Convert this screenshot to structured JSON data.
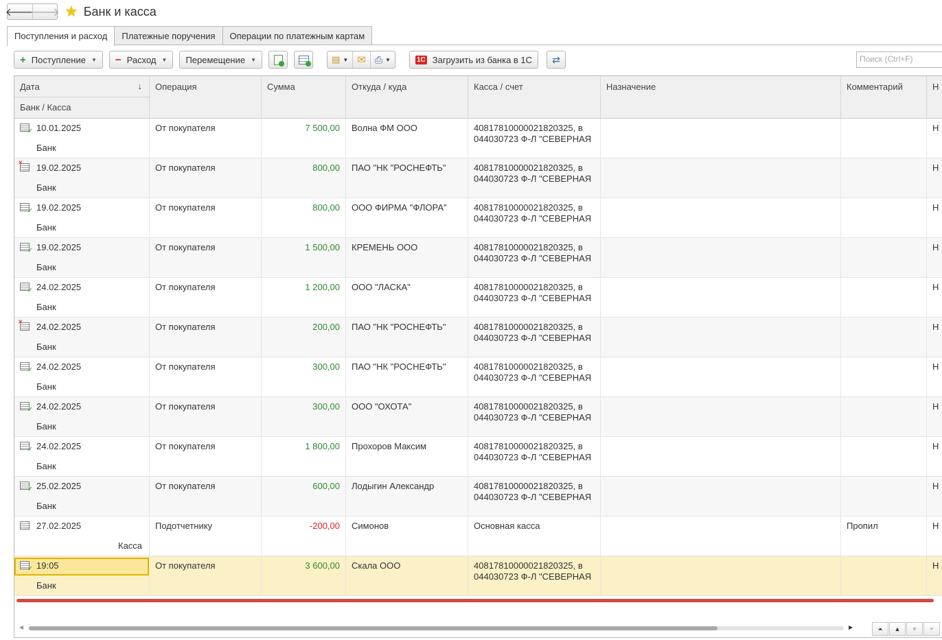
{
  "window": {
    "title": "Банк и касса"
  },
  "tabs": [
    "Поступления и расход",
    "Платежные поручения",
    "Операции по платежным картам"
  ],
  "toolbar": {
    "income_label": "Поступление",
    "expense_label": "Расход",
    "move_label": "Перемещение",
    "load_label": "Загрузить из банка в 1С",
    "c1_badge": "1С"
  },
  "search": {
    "placeholder": "Поиск (Ctrl+F)"
  },
  "columns": {
    "date": "Дата",
    "bank": "Банк / Касса",
    "operation": "Операция",
    "sum": "Сумма",
    "from": "Откуда / куда",
    "account": "Касса / счет",
    "purpose": "Назначение",
    "comment": "Комментарий",
    "last": "Н"
  },
  "rows": [
    {
      "status": "posted",
      "date": "10.01.2025",
      "kind": "Банк",
      "op": "От покупателя",
      "sum": "7 500,00",
      "sign": "income",
      "from": "Волна ФМ ООО",
      "acc1": "40817810000021820325, в",
      "acc2": "044030723 Ф-Л \"СЕВЕРНАЯ",
      "comment": "",
      "last": "Н"
    },
    {
      "status": "deleted",
      "date": "19.02.2025",
      "kind": "Банк",
      "op": "От покупателя",
      "sum": "800,00",
      "sign": "income",
      "from": "ПАО \"НК \"РОСНЕФТЬ\"",
      "acc1": "40817810000021820325, в",
      "acc2": "044030723 Ф-Л \"СЕВЕРНАЯ",
      "comment": "",
      "last": "Н"
    },
    {
      "status": "posted",
      "date": "19.02.2025",
      "kind": "Банк",
      "op": "От покупателя",
      "sum": "800,00",
      "sign": "income",
      "from": "ООО ФИРМА \"ФЛОРА\"",
      "acc1": "40817810000021820325, в",
      "acc2": "044030723 Ф-Л \"СЕВЕРНАЯ",
      "comment": "",
      "last": "Н"
    },
    {
      "status": "posted",
      "date": "19.02.2025",
      "kind": "Банк",
      "op": "От покупателя",
      "sum": "1 500,00",
      "sign": "income",
      "from": "КРЕМЕНЬ ООО",
      "acc1": "40817810000021820325, в",
      "acc2": "044030723 Ф-Л \"СЕВЕРНАЯ",
      "comment": "",
      "last": "Н"
    },
    {
      "status": "posted",
      "date": "24.02.2025",
      "kind": "Банк",
      "op": "От покупателя",
      "sum": "1 200,00",
      "sign": "income",
      "from": "ООО \"ЛАСКА\"",
      "acc1": "40817810000021820325, в",
      "acc2": "044030723 Ф-Л \"СЕВЕРНАЯ",
      "comment": "",
      "last": "Н"
    },
    {
      "status": "deleted",
      "date": "24.02.2025",
      "kind": "Банк",
      "op": "От покупателя",
      "sum": "200,00",
      "sign": "income",
      "from": "ПАО \"НК \"РОСНЕФТЬ\"",
      "acc1": "40817810000021820325, в",
      "acc2": "044030723 Ф-Л \"СЕВЕРНАЯ",
      "comment": "",
      "last": "Н"
    },
    {
      "status": "posted",
      "date": "24.02.2025",
      "kind": "Банк",
      "op": "От покупателя",
      "sum": "300,00",
      "sign": "income",
      "from": "ПАО \"НК \"РОСНЕФТЬ\"",
      "acc1": "40817810000021820325, в",
      "acc2": "044030723 Ф-Л \"СЕВЕРНАЯ",
      "comment": "",
      "last": "Н"
    },
    {
      "status": "posted",
      "date": "24.02.2025",
      "kind": "Банк",
      "op": "От покупателя",
      "sum": "300,00",
      "sign": "income",
      "from": "ООО \"ОХОТА\"",
      "acc1": "40817810000021820325, в",
      "acc2": "044030723 Ф-Л \"СЕВЕРНАЯ",
      "comment": "",
      "last": "Н"
    },
    {
      "status": "posted",
      "date": "24.02.2025",
      "kind": "Банк",
      "op": "От покупателя",
      "sum": "1 800,00",
      "sign": "income",
      "from": "Прохоров Максим",
      "acc1": "40817810000021820325, в",
      "acc2": "044030723 Ф-Л \"СЕВЕРНАЯ",
      "comment": "",
      "last": "Н"
    },
    {
      "status": "posted",
      "date": "25.02.2025",
      "kind": "Банк",
      "op": "От покупателя",
      "sum": "600,00",
      "sign": "income",
      "from": "Лодыгин Александр",
      "acc1": "40817810000021820325, в",
      "acc2": "044030723 Ф-Л \"СЕВЕРНАЯ",
      "comment": "",
      "last": "Н"
    },
    {
      "status": "draft",
      "date": "27.02.2025",
      "kind": "Касса",
      "op": "Подотчетнику",
      "sum": "-200,00",
      "sign": "expense",
      "from": "Симонов",
      "acc1": "Основная касса",
      "acc2": "",
      "comment": "Пропил",
      "last": "Н"
    },
    {
      "status": "posted",
      "date": "19:05",
      "kind": "Банк",
      "op": "От покупателя",
      "sum": "3 600,00",
      "sign": "income",
      "from": "Скала ООО",
      "acc1": "40817810000021820325, в",
      "acc2": "044030723 Ф-Л \"СЕВЕРНАЯ",
      "comment": "",
      "last": "Н",
      "selected": true
    }
  ],
  "colors": {
    "income": "#2e8a2e",
    "expense": "#dd2222",
    "selection": "#fbf0c6",
    "accent_star": "#f4c20d"
  }
}
